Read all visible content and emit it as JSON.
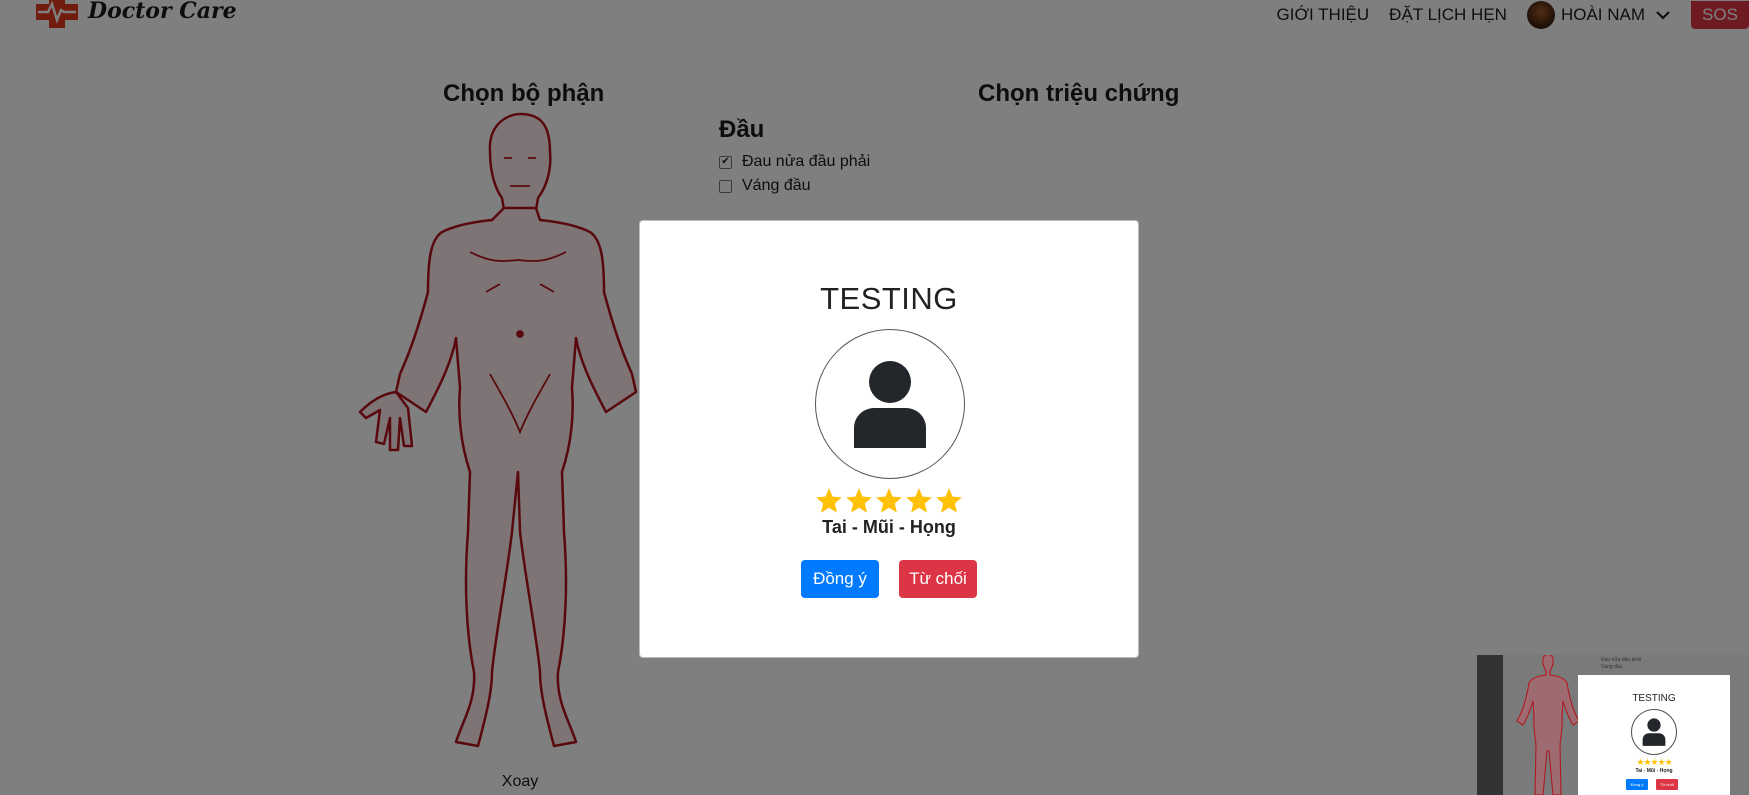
{
  "brand": {
    "name": "Doctor Care"
  },
  "nav": {
    "items": [
      "GIỚI THIỆU",
      "ĐẶT LỊCH HẸN"
    ],
    "user_name": "HOÀI NAM",
    "sos_label": "SOS"
  },
  "body_section": {
    "title": "Chọn bộ phận",
    "rotate_label": "Xoay"
  },
  "symptom_section": {
    "title": "Chọn triệu chứng",
    "group": "Đầu",
    "symptoms": [
      {
        "label": "Đau nửa đầu phải",
        "checked": true
      },
      {
        "label": "Váng đầu",
        "checked": false
      }
    ]
  },
  "modal": {
    "title": "TESTING",
    "rating": 5,
    "specialty": "Tai - Mũi - Họng",
    "accept_label": "Đồng ý",
    "reject_label": "Từ chối"
  },
  "colors": {
    "primary": "#007bff",
    "danger": "#dc3545",
    "star": "#ffc107",
    "body_outline": "#b3121b"
  }
}
